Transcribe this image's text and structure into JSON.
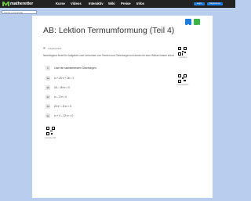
{
  "header": {
    "logo_text": "matheretter",
    "nav": [
      "Kurse",
      "Videos",
      "Interaktiv",
      "Wiki",
      "Preise",
      "Infos"
    ],
    "login_label": "Login",
    "register_label": "Registrieren"
  },
  "search": {
    "placeholder": "Suche Lehrinhalte"
  },
  "article": {
    "title": "AB: Lektion Termumformung (Teil 4)",
    "meta": "Aufgabenblatt",
    "intro": "Nachfolgend findet ihr Aufgaben zum Umformen von Termen und Gleichungen mit denen ihr euer Wissen testen könnt.",
    "tasks": [
      {
        "num": "1",
        "text": "Löse die nachstehenden Gleichungen."
      },
      {
        "num": "1a",
        "text": "x² + 20·x + 16 = 1"
      },
      {
        "num": "1b",
        "text": "16 – 16·x² = 0"
      },
      {
        "num": "1c",
        "text": "x² – 3·x = 0"
      },
      {
        "num": "1d",
        "text": "20·x⁴ – 8·x² = 0"
      },
      {
        "num": "1e",
        "text": "x² + 4 – 12·x² = 0"
      }
    ],
    "qr_captions": [
      "Lösungen",
      "Lösungsvideo",
      "Lösungen AB"
    ]
  },
  "colors": {
    "background": "#b9cdee",
    "header_bg": "#222222",
    "logo_green": "#6cc04a",
    "accent_blue": "#1e7be0",
    "icon_green": "#3bb54a"
  },
  "icons": [
    "logo-m-icon",
    "share-icon",
    "print-icon"
  ]
}
